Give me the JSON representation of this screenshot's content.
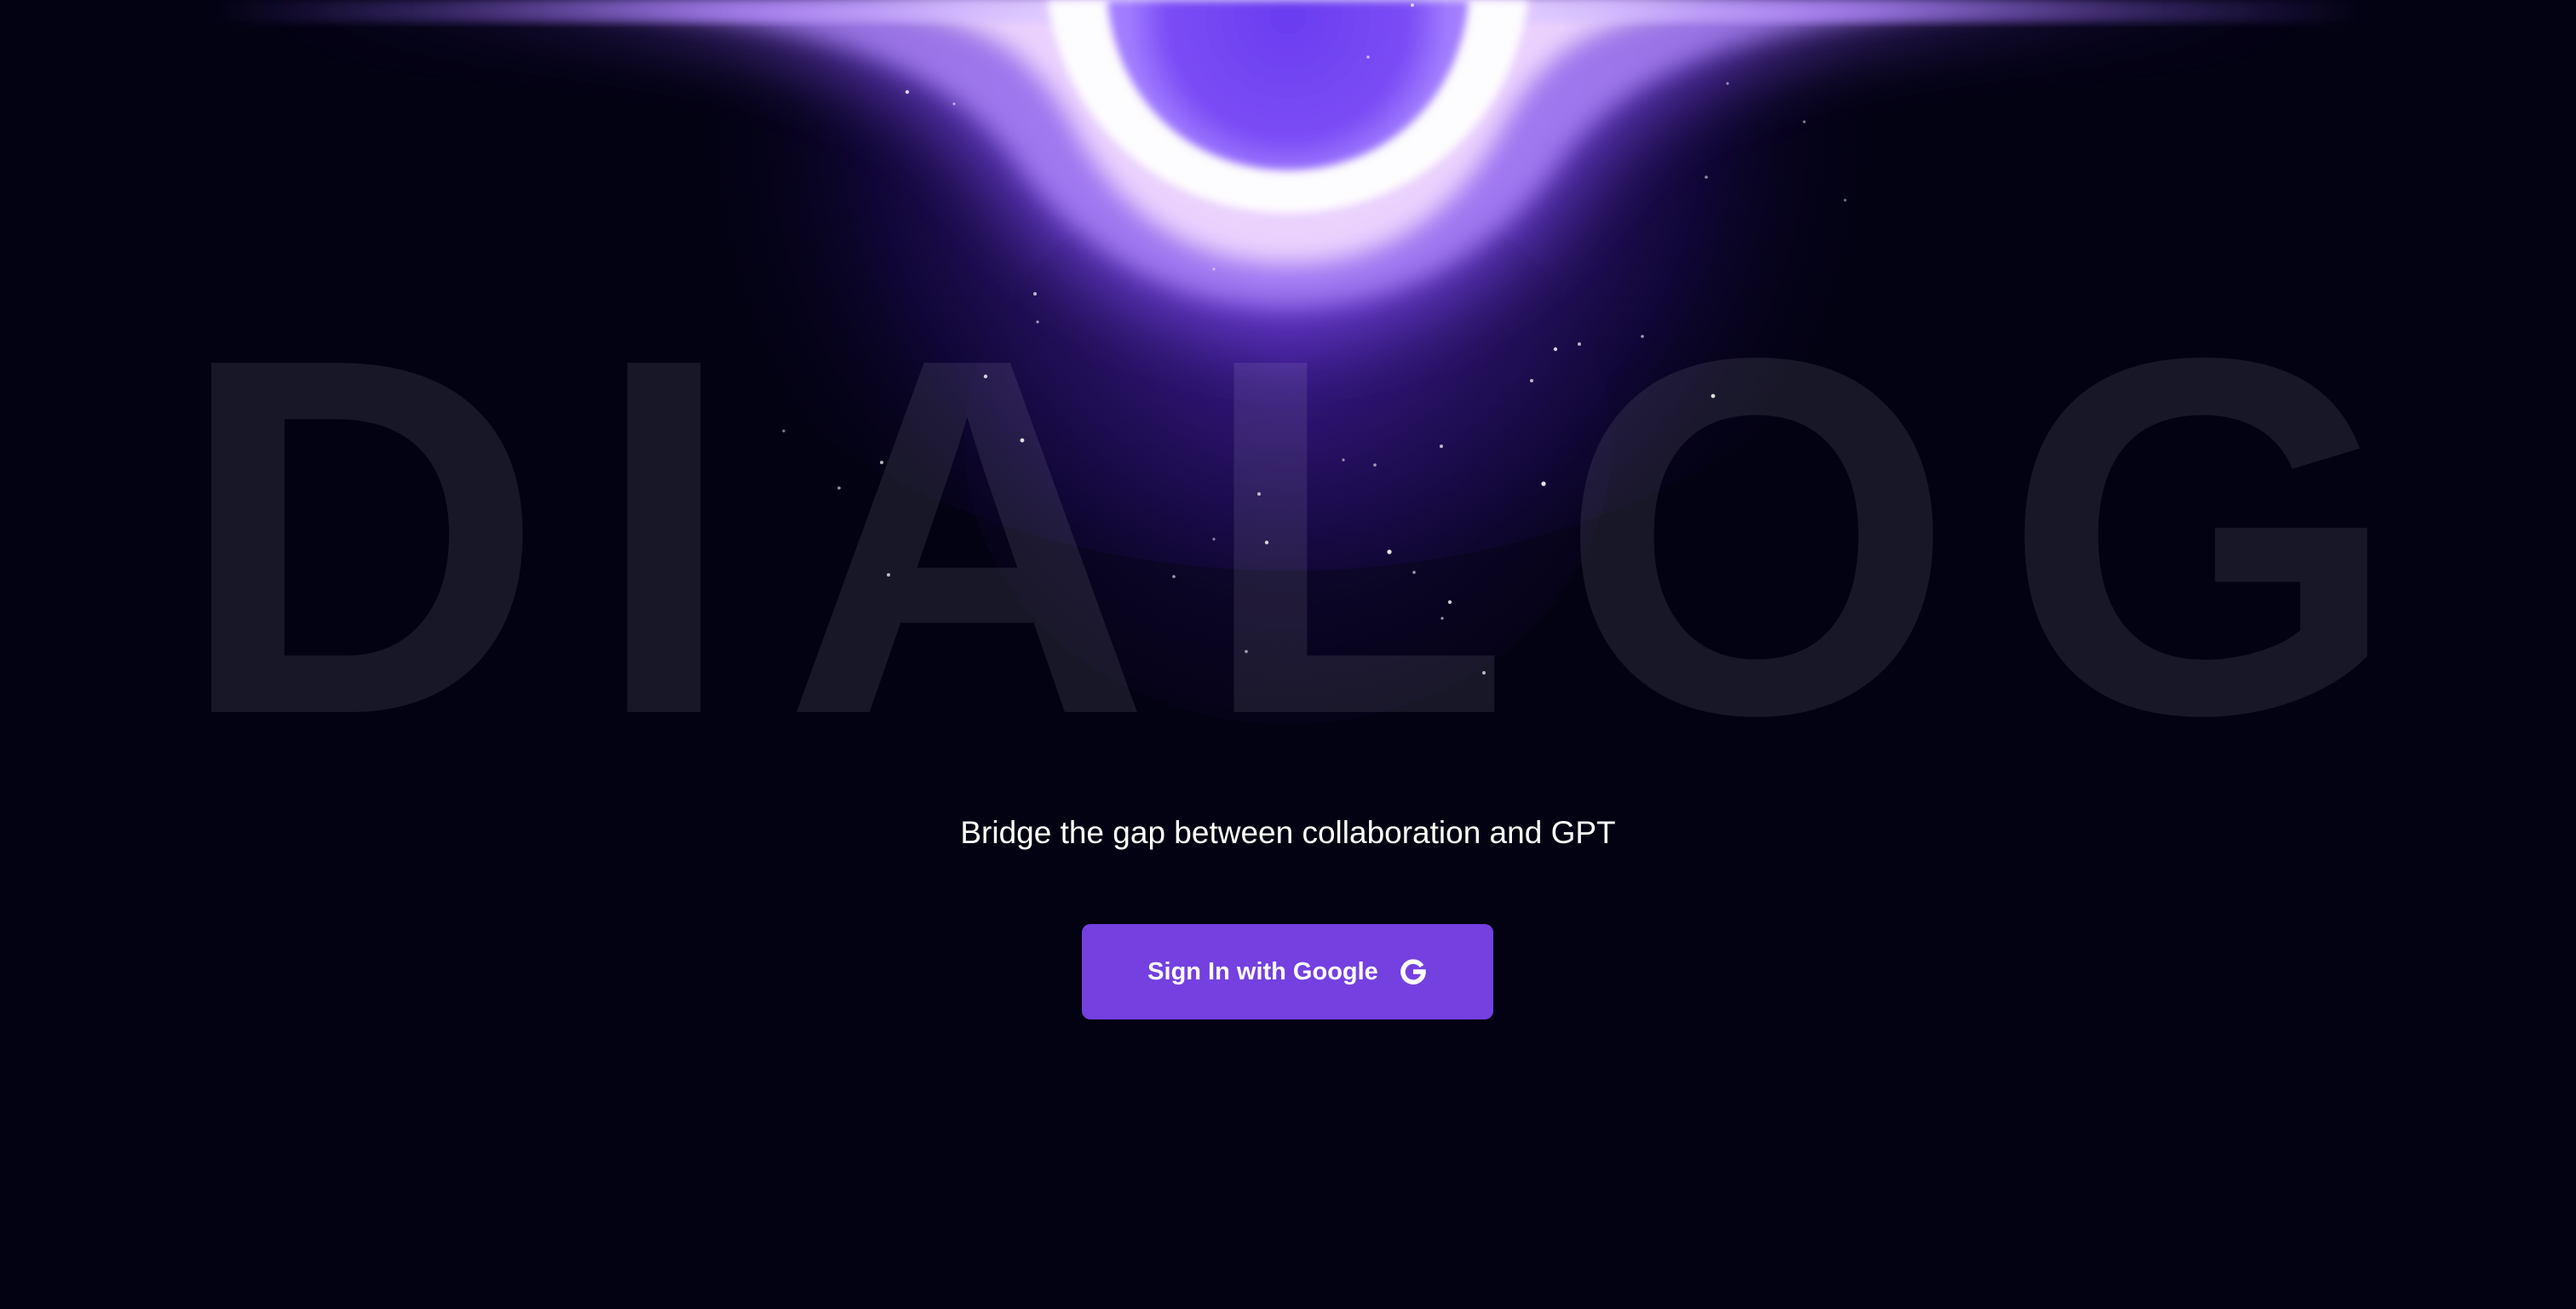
{
  "hero": {
    "brand_word": "DIALOG",
    "tagline": "Bridge the gap between collaboration and GPT"
  },
  "auth": {
    "signin_label": "Sign In with Google",
    "signin_icon": "google-icon"
  },
  "colors": {
    "background": "#030213",
    "accent": "#7440e0",
    "glow": "#8a5cff",
    "text": "#ffffff"
  }
}
